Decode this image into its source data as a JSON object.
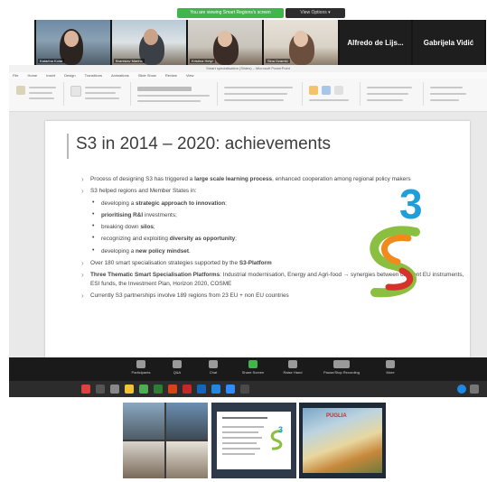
{
  "zoom": {
    "share_banner": "You are viewing Smart Regions's screen",
    "view_options": "View Options ▾"
  },
  "participants": [
    {
      "name": "Katarina Kolar"
    },
    {
      "name": "Branislav Marinc"
    },
    {
      "name": "Kristina Helyr"
    },
    {
      "name": "Sina Dzamlo"
    },
    {
      "name": "Alfredo de Lijs..."
    },
    {
      "name": "Gabrijela Vidić"
    }
  ],
  "powerpoint": {
    "window_title": "Smart specialisation (Slides) – Microsoft PowerPoint",
    "tabs": [
      "File",
      "Home",
      "Insert",
      "Design",
      "Transitions",
      "Animations",
      "Slide Show",
      "Review",
      "View"
    ]
  },
  "slide": {
    "title": "S3 in 2014 – 2020: achievements",
    "bullet1_pre": "Process of designing S3 has triggered a ",
    "bullet1_bold": "large scale learning process",
    "bullet1_post": ", enhanced cooperation among regional policy makers",
    "bullet2": "S3 helped regions and Member States in:",
    "sub1_pre": "developing a ",
    "sub1_bold": "strategic approach to innovation",
    "sub1_post": ";",
    "sub2_bold": "prioritising R&I",
    "sub2_post": " investments;",
    "sub3_pre": "breaking down ",
    "sub3_bold": "silos",
    "sub3_post": ";",
    "sub4_pre": "recognizing and exploiting ",
    "sub4_bold": "diversity as opportunity",
    "sub4_post": ";",
    "sub5_pre": "developing a ",
    "sub5_bold": "new policy mindset",
    "sub5_post": ".",
    "bullet3_pre": "Over 180 smart specialisation strategies supported by the ",
    "bullet3_bold": "S3-Platform",
    "bullet4_bold": "Three Thematic Smart Specialisation Platforms",
    "bullet4_post": ": Industrial modernisation, Energy and Agri-food → synergies between different EU instruments, ESI funds, the Investment Plan, Horizon 2020, COSME",
    "bullet5": "Currently S3 partnerships involve 189 regions from 23 EU + non EU countries"
  },
  "toolbar": {
    "items": [
      "Participants",
      "Q&A",
      "Chat",
      "Share Screen",
      "Raise Hand",
      "Pause/Stop Recording",
      "More"
    ]
  },
  "collage": {
    "puglia_label": "PUGLIA"
  },
  "colors": {
    "banner_green": "#3fb54a",
    "logo_green": "#8bbf3f",
    "logo_orange": "#f28a1b",
    "logo_red": "#d6322b",
    "logo_blue": "#1f9ed9"
  }
}
